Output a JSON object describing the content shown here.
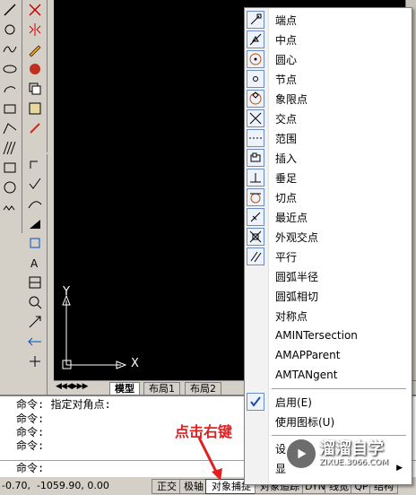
{
  "canvas": {
    "y_axis_label": "Y",
    "x_axis_label": "X"
  },
  "layout_tabs": [
    "模型",
    "布局1",
    "布局2"
  ],
  "command": {
    "lines": [
      "命令: 指定对角点:",
      "命令:",
      "命令:",
      "命令:"
    ],
    "prompt": "命令:"
  },
  "status": {
    "coords": "-0.70,  -1059.90, 0.00",
    "buttons": [
      "正交",
      "极轴",
      "对象捕捉",
      "对象追踪",
      "DYN",
      "线宽",
      "QP",
      "结构"
    ]
  },
  "context_menu": {
    "snap_items": [
      {
        "label": "端点",
        "icon": "endpoint-icon"
      },
      {
        "label": "中点",
        "icon": "midpoint-icon"
      },
      {
        "label": "圆心",
        "icon": "center-icon"
      },
      {
        "label": "节点",
        "icon": "node-icon"
      },
      {
        "label": "象限点",
        "icon": "quadrant-icon"
      },
      {
        "label": "交点",
        "icon": "intersection-icon"
      },
      {
        "label": "范围",
        "icon": "extension-icon"
      },
      {
        "label": "插入",
        "icon": "insertion-icon"
      },
      {
        "label": "垂足",
        "icon": "perpendicular-icon"
      },
      {
        "label": "切点",
        "icon": "tangent-icon"
      },
      {
        "label": "最近点",
        "icon": "nearest-icon"
      },
      {
        "label": "外观交点",
        "icon": "apparent-intersection-icon"
      },
      {
        "label": "平行",
        "icon": "parallel-icon"
      }
    ],
    "text_items": [
      "圆弧半径",
      "圆弧相切",
      "对称点",
      "AMINTersection",
      "AMAPParent",
      "AMTANgent"
    ],
    "enable_label": "启用(E)",
    "enable_checked": true,
    "use_icons_label": "使用图标(U)",
    "settings_label": "设",
    "display_label": "显"
  },
  "annotation": {
    "text": "点击右键",
    "color": "#e02020"
  },
  "watermark": {
    "title": "溜溜自学",
    "url": "ZIXUE.3066.COM"
  }
}
